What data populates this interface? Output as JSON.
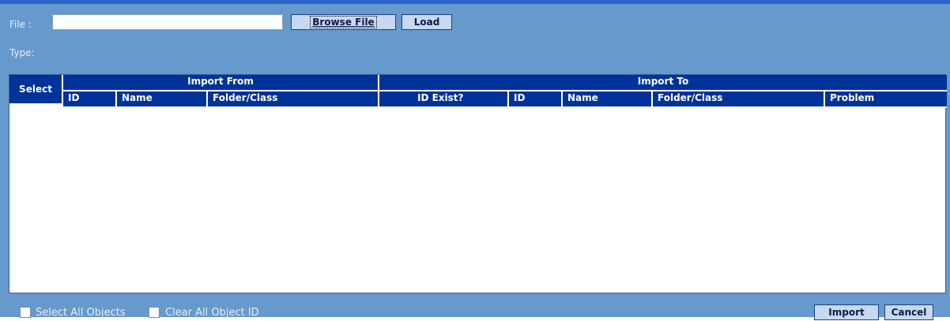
{
  "file_row": {
    "label": "File :",
    "input_value": "",
    "browse_label": "Browse File",
    "load_label": "Load"
  },
  "type_row": {
    "label": "Type:"
  },
  "table": {
    "select_header": "Select",
    "group_from": "Import From",
    "group_to": "Import To",
    "from_columns": [
      "ID",
      "Name",
      "Folder/Class"
    ],
    "to_columns": [
      "ID Exist?",
      "ID",
      "Name",
      "Folder/Class",
      "Problem"
    ],
    "rows": []
  },
  "options": {
    "select_all_label": "Select All Objects",
    "clear_all_label": "Clear All Object ID",
    "select_all_checked": false,
    "clear_all_checked": false
  },
  "actions": {
    "import_label": "Import",
    "cancel_label": "Cancel"
  },
  "colors": {
    "panel": "#6699cc",
    "header": "#003399",
    "top_border": "#2a64c8"
  }
}
